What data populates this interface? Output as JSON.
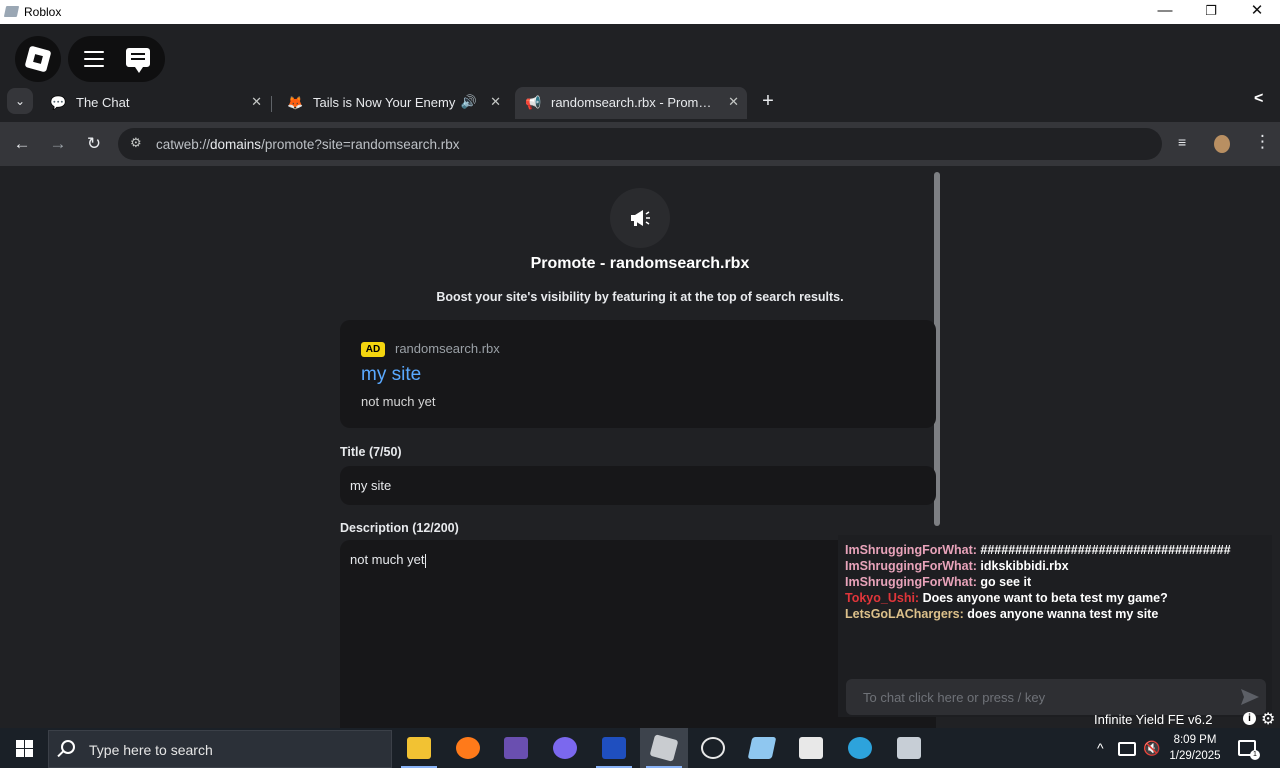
{
  "window": {
    "title": "Roblox",
    "controls": {
      "minimize": "—",
      "restore": "❐",
      "close": "✕"
    }
  },
  "tabs": [
    {
      "label": "The Chat",
      "icon": "chat-icon",
      "close": "✕"
    },
    {
      "label": "Tails is Now Your Enemy",
      "icon": "tails-icon",
      "audio": "🔊",
      "close": "✕"
    },
    {
      "label": "randomsearch.rbx - Prom…",
      "icon": "megaphone-icon",
      "close": "✕",
      "active": true
    }
  ],
  "tabbar": {
    "dropdown": "⌄",
    "new_tab": "+",
    "collapse": "<"
  },
  "address": {
    "scheme": "catweb://",
    "domain": "domains",
    "path": "/promote?site=randomsearch.rbx"
  },
  "nav": {
    "back": "←",
    "forward": "→",
    "reload": "↻",
    "settings": "⚙",
    "menu": "⋮",
    "reading_list": "≡"
  },
  "page": {
    "title": "Promote - randomsearch.rbx",
    "subtitle": "Boost your site's visibility by featuring it at the top of search results.",
    "preview": {
      "badge": "AD",
      "domain": "randomsearch.rbx",
      "title": "my site",
      "description": "not much yet"
    },
    "title_field": {
      "label": "Title (7/50)",
      "value": "my site"
    },
    "description_field": {
      "label": "Description (12/200)",
      "value": "not much yet"
    }
  },
  "chat": {
    "messages": [
      {
        "user": "ImShruggingForWhat:",
        "text": " ####################################",
        "color": "#e8a3ba"
      },
      {
        "user": "ImShruggingForWhat:",
        "text": " idkskibbidi.rbx",
        "color": "#e8a3ba"
      },
      {
        "user": "ImShruggingForWhat:",
        "text": " go see it",
        "color": "#e8a3ba"
      },
      {
        "user": "Tokyo_Ushi:",
        "text": " Does anyone want to beta test my game?",
        "color": "#e0353a"
      },
      {
        "user": "LetsGoLAChargers:",
        "text": " does anyone wanna test my site",
        "color": "#dcc08a"
      }
    ],
    "placeholder": "To chat click here or press / key"
  },
  "overlay": {
    "label": "Infinite Yield FE v6.2",
    "info": "i",
    "gear": "⚙"
  },
  "taskbar": {
    "search_placeholder": "Type here to search",
    "time": "8:09 PM",
    "date": "1/29/2025",
    "tray_chevron": "^",
    "notif_count": "1",
    "apps": [
      {
        "name": "file-explorer-icon",
        "color": "#f2c233"
      },
      {
        "name": "firefox-icon",
        "color": "#ff7a1a"
      },
      {
        "name": "game-icon",
        "color": "#6a4fb0"
      },
      {
        "name": "browser-icon",
        "color": "#7b68ee"
      },
      {
        "name": "editor-icon",
        "color": "#1f4fbf"
      },
      {
        "name": "roblox-icon",
        "color": "#c9ccd0"
      },
      {
        "name": "star-app-icon",
        "color": "#e8e8e8"
      },
      {
        "name": "studio-icon",
        "color": "#8fc7f0"
      },
      {
        "name": "7zip-icon",
        "color": "#e8e8e8"
      },
      {
        "name": "edge-icon",
        "color": "#2da3dc"
      },
      {
        "name": "app-icon",
        "color": "#c7ced6"
      }
    ]
  }
}
